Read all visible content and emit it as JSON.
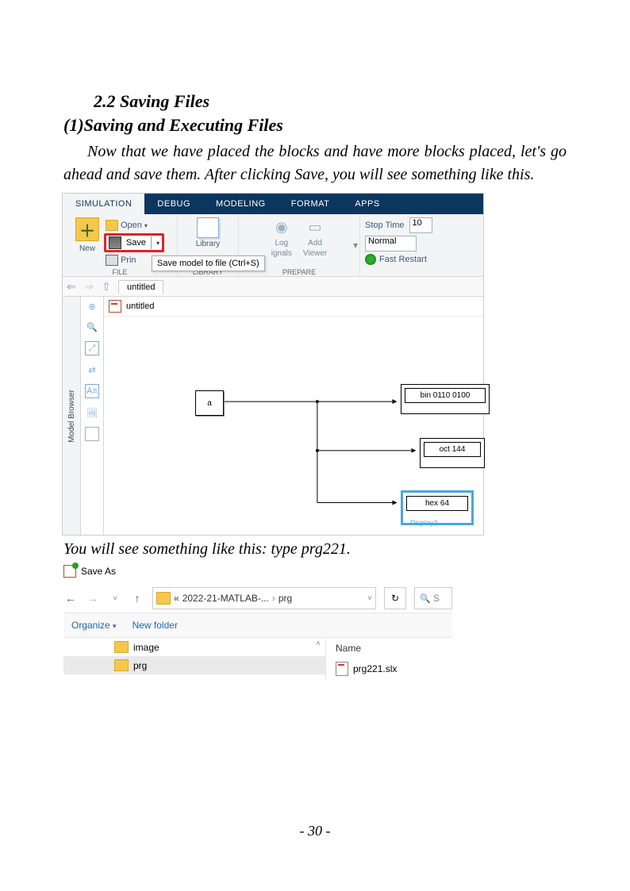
{
  "heading_section": "2.2   Saving Files",
  "heading_sub": "(1)Saving and Executing Files",
  "para1": "Now that we have placed the blocks and have more blocks placed, let's go ahead and save them. After clicking Save, you will see something like this.",
  "para2": "You will see something like this: type prg221.",
  "page_number": "- 30 -",
  "sim": {
    "tabs": [
      "SIMULATION",
      "DEBUG",
      "MODELING",
      "FORMAT",
      "APPS"
    ],
    "new_label": "New",
    "open_label": "Open",
    "save_label": "Save",
    "print_label": "Prin",
    "tooltip": "Save model to file (Ctrl+S)",
    "library_label": "Library",
    "log_label": "Log",
    "log_sub": "ignals",
    "add_label": "Add",
    "add_sub": "Viewer",
    "group_file": "FILE",
    "group_library": "LIBRARY",
    "group_prepare": "PREPARE",
    "stoptime_label": "Stop Time",
    "stoptime_value": "10",
    "normal_label": "Normal",
    "fastrestart_label": "Fast Restart",
    "breadcrumb": "untitled",
    "browser_label": "Model Browser",
    "tabname": "untitled",
    "block_a": "a",
    "disp1": "bin 0110 0100",
    "disp2": "oct 144",
    "disp3": "hex 64",
    "disp3_label": "Display2"
  },
  "saveas": {
    "title": "Save As",
    "path_prefix": "«",
    "path_seg1": "2022-21-MATLAB-...",
    "path_seg2": "prg",
    "organize": "Organize",
    "newfolder": "New folder",
    "tree_image": "image",
    "tree_prg": "prg",
    "name_header": "Name",
    "file1": "prg221.slx",
    "search_placeholder": "S"
  }
}
